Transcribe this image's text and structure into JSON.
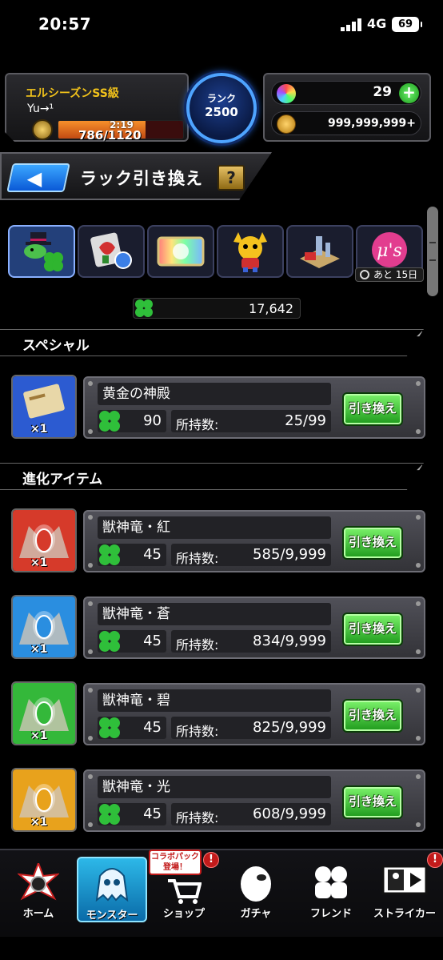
{
  "status_bar": {
    "time": "20:57",
    "network": "4G",
    "battery": "69"
  },
  "player": {
    "rank_class": "エルシーズンSS級",
    "name": "Yu→¹",
    "stamina_timer": "2:19",
    "stamina": "786/1120",
    "stamina_fraction": 0.7
  },
  "rank": {
    "label": "ランク",
    "value": "2500"
  },
  "currency": {
    "orbs": "29",
    "gold": "999,999,999+"
  },
  "title": {
    "text": "ラック引き換え",
    "help": "?"
  },
  "categories": [
    {
      "icon": "clover-hat-icon",
      "active": true
    },
    {
      "icon": "potion-icon",
      "active": false
    },
    {
      "icon": "rainbow-ticket-icon",
      "active": false
    },
    {
      "icon": "monster-character-icon",
      "active": false
    },
    {
      "icon": "tower-stage-icon",
      "active": false
    },
    {
      "icon": "collab-logo-icon",
      "active": false
    }
  ],
  "deadline": "あと 15日",
  "luck_total": "17,642",
  "sections": {
    "special": "スペシャル",
    "evolution": "進化アイテム"
  },
  "exchange_label": "引き換え",
  "owned_label": "所持数:",
  "special_items": [
    {
      "name": "黄金の神殿",
      "cost": "90",
      "owned": "25/99",
      "qty": "×1",
      "color": "#2c5bd1"
    }
  ],
  "evolution_items": [
    {
      "name": "獣神竜・紅",
      "cost": "45",
      "owned": "585/9,999",
      "qty": "×1",
      "color": "#d63a2a"
    },
    {
      "name": "獣神竜・蒼",
      "cost": "45",
      "owned": "834/9,999",
      "qty": "×1",
      "color": "#2a8ee0"
    },
    {
      "name": "獣神竜・碧",
      "cost": "45",
      "owned": "825/9,999",
      "qty": "×1",
      "color": "#34b83a"
    },
    {
      "name": "獣神竜・光",
      "cost": "45",
      "owned": "608/9,999",
      "qty": "×1",
      "color": "#e8a21c"
    }
  ],
  "bottom_nav": {
    "home": "ホーム",
    "monster": "モンスター",
    "shop": "ショップ",
    "gacha": "ガチャ",
    "friend": "フレンド",
    "striker": "ストライカー",
    "collab_badge": "コラボパック登場！"
  }
}
